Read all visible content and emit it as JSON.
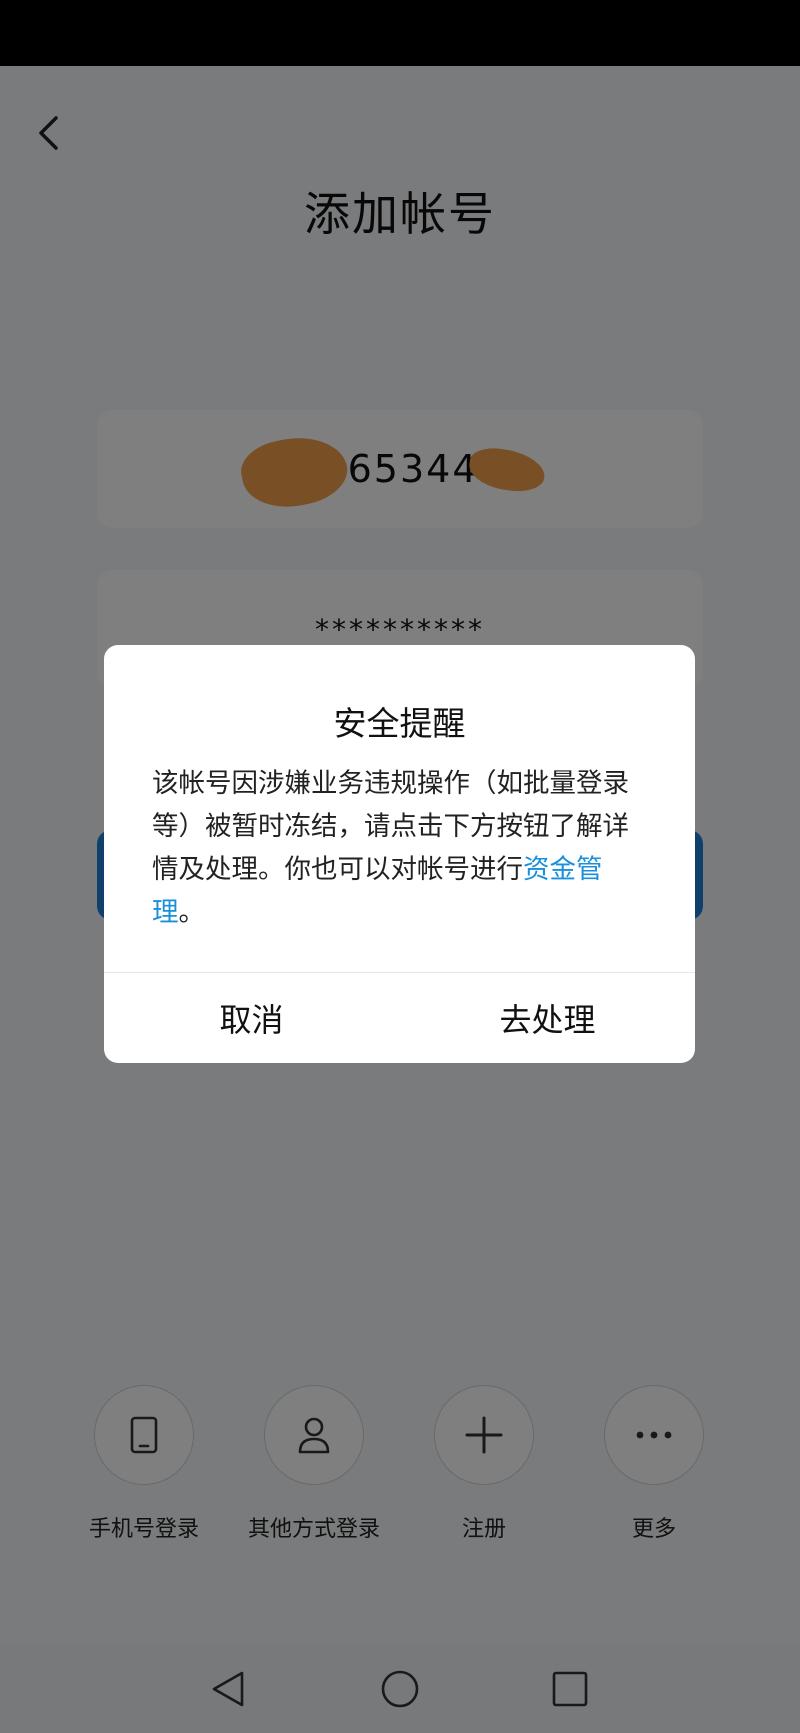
{
  "page": {
    "title": "添加帐号"
  },
  "account": {
    "visible_digits": "21653442"
  },
  "password": {
    "masked_value": "**********"
  },
  "bottom_options": [
    {
      "label": "手机号登录",
      "icon": "phone-icon"
    },
    {
      "label": "其他方式登录",
      "icon": "person-icon"
    },
    {
      "label": "注册",
      "icon": "plus-icon"
    },
    {
      "label": "更多",
      "icon": "more-icon"
    }
  ],
  "dialog": {
    "title": "安全提醒",
    "message_prefix": "该帐号因涉嫌业务违规操作（如批量登录等）被暂时冻结，请点击下方按钮了解详情及处理。你也可以对帐号进行",
    "message_link": "资金管理",
    "message_suffix": "。",
    "cancel_label": "取消",
    "confirm_label": "去处理"
  },
  "nav": {
    "back_icon": "triangle-back-icon",
    "home_icon": "circle-home-icon",
    "recents_icon": "square-recents-icon"
  },
  "colors": {
    "accent": "#1a8fdc",
    "primary_button": "#1f7fd6",
    "redaction": "#f29e4c",
    "overlay": "rgba(0,0,0,0.5)"
  }
}
